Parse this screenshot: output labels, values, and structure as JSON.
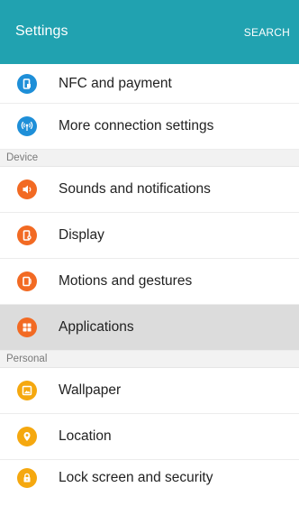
{
  "header": {
    "title": "Settings",
    "search_label": "SEARCH"
  },
  "colors": {
    "appbar": "#21a2b0",
    "blue": "#1e8fd8",
    "orange": "#f26a23",
    "yellow": "#f5a80f"
  },
  "groups": {
    "connections": [
      {
        "label": "NFC and payment",
        "icon": "nfc-icon"
      },
      {
        "label": "More connection settings",
        "icon": "wireless-icon"
      }
    ],
    "device": {
      "header": "Device",
      "items": [
        {
          "label": "Sounds and notifications",
          "icon": "speaker-icon"
        },
        {
          "label": "Display",
          "icon": "display-icon"
        },
        {
          "label": "Motions and gestures",
          "icon": "motion-icon"
        },
        {
          "label": "Applications",
          "icon": "apps-grid-icon",
          "selected": true
        }
      ]
    },
    "personal": {
      "header": "Personal",
      "items": [
        {
          "label": "Wallpaper",
          "icon": "wallpaper-icon"
        },
        {
          "label": "Location",
          "icon": "location-pin-icon"
        },
        {
          "label": "Lock screen and security",
          "icon": "lock-icon"
        }
      ]
    }
  }
}
